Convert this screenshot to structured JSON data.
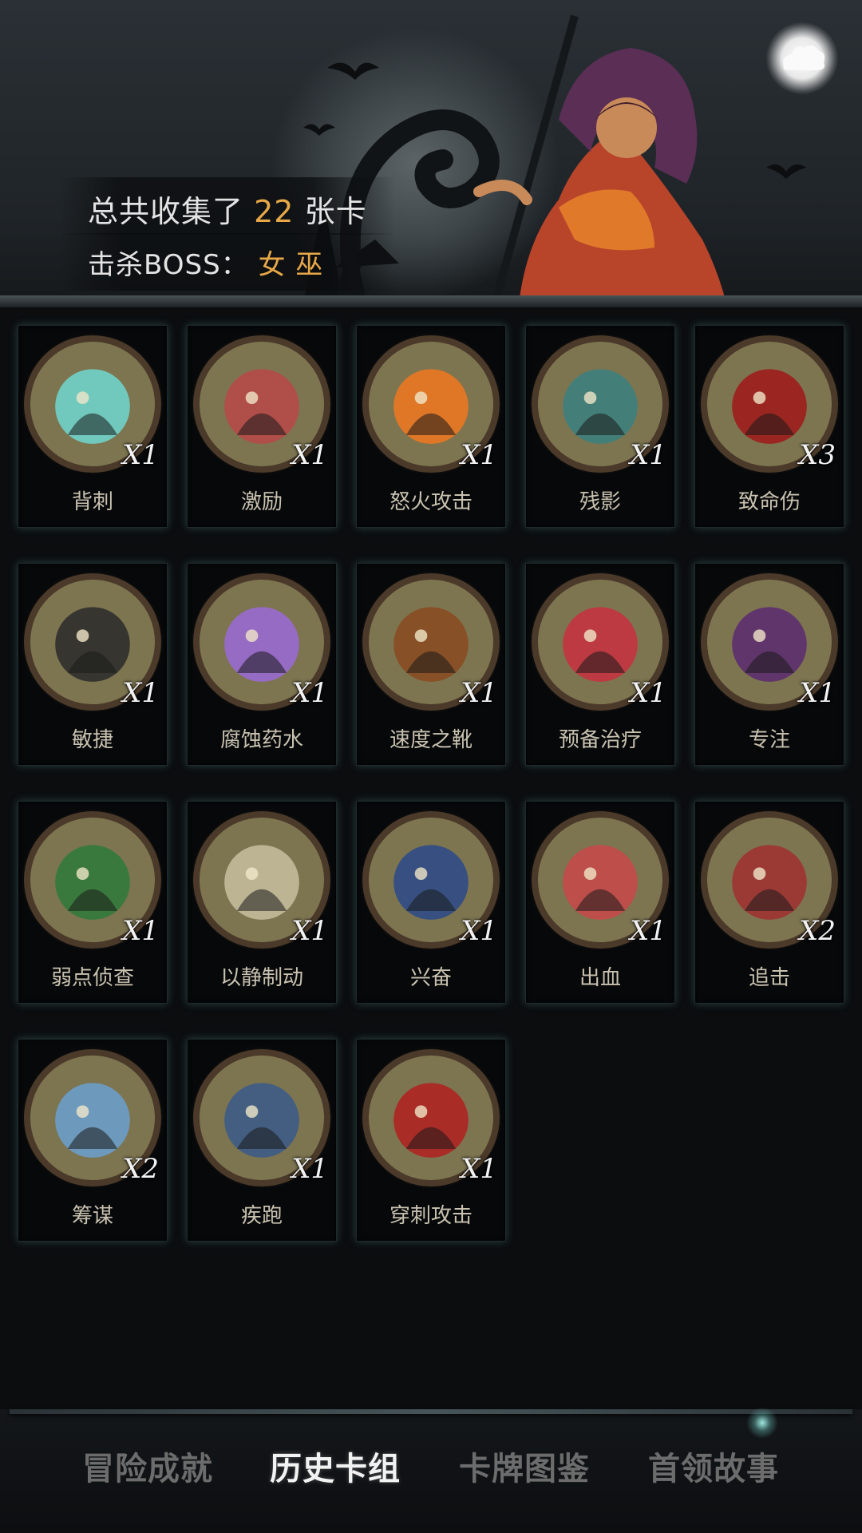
{
  "header": {
    "collected_prefix": "总共收集了",
    "collected_count": "22",
    "collected_suffix": "张卡",
    "boss_label": "击杀BOSS：",
    "boss_name": "女 巫",
    "menu_icon": "cloud-menu-icon"
  },
  "cards": [
    {
      "name": "背刺",
      "count": "X1",
      "icon": "puppet-slash-icon",
      "color": "#6fd8d0"
    },
    {
      "name": "激励",
      "count": "X1",
      "icon": "hammer-warrior-icon",
      "color": "#b84848"
    },
    {
      "name": "怒火攻击",
      "count": "X1",
      "icon": "flame-slash-icon",
      "color": "#f07820"
    },
    {
      "name": "残影",
      "count": "X1",
      "icon": "hooded-figures-icon",
      "color": "#3a8080"
    },
    {
      "name": "致命伤",
      "count": "X3",
      "icon": "bleeding-dagger-icon",
      "color": "#a01818"
    },
    {
      "name": "敏捷",
      "count": "X1",
      "icon": "panther-icon",
      "color": "#2a2a2a"
    },
    {
      "name": "腐蚀药水",
      "count": "X1",
      "icon": "potion-icon",
      "color": "#9a6ad8"
    },
    {
      "name": "速度之靴",
      "count": "X1",
      "icon": "boot-icon",
      "color": "#8a4a20"
    },
    {
      "name": "预备治疗",
      "count": "X1",
      "icon": "heart-cross-icon",
      "color": "#c83040"
    },
    {
      "name": "专注",
      "count": "X1",
      "icon": "wizard-icon",
      "color": "#5a2a70"
    },
    {
      "name": "弱点侦查",
      "count": "X1",
      "icon": "wolf-icon",
      "color": "#2e7a3a"
    },
    {
      "name": "以静制动",
      "count": "X1",
      "icon": "skull-icon",
      "color": "#c8c0a0"
    },
    {
      "name": "兴奋",
      "count": "X1",
      "icon": "dwarf-hammer-icon",
      "color": "#2a4a8a"
    },
    {
      "name": "出血",
      "count": "X1",
      "icon": "octopus-icon",
      "color": "#c84848"
    },
    {
      "name": "追击",
      "count": "X2",
      "icon": "pirate-icon",
      "color": "#a03030"
    },
    {
      "name": "筹谋",
      "count": "X2",
      "icon": "map-icon",
      "color": "#6aa0d0"
    },
    {
      "name": "疾跑",
      "count": "X1",
      "icon": "werewolf-icon",
      "color": "#3a5a8a"
    },
    {
      "name": "穿刺攻击",
      "count": "X1",
      "icon": "spikes-icon",
      "color": "#b02020"
    }
  ],
  "tabs": [
    {
      "label": "冒险成就",
      "active": false
    },
    {
      "label": "历史卡组",
      "active": true
    },
    {
      "label": "卡牌图鉴",
      "active": false
    },
    {
      "label": "首领故事",
      "active": false
    }
  ],
  "colors": {
    "accent": "#e8a848",
    "medal_bg": "#7d7550",
    "card_glow": "#78c8be"
  }
}
